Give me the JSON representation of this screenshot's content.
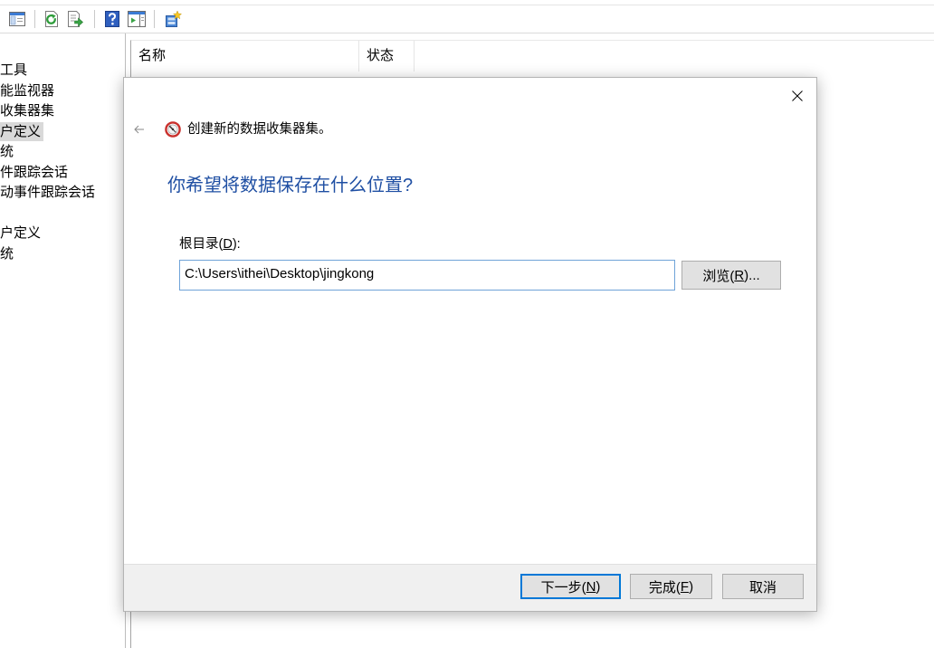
{
  "toolbar": {
    "icons": {
      "console_tree": "show-hide-console-tree-icon",
      "refresh": "refresh-icon",
      "export": "export-list-icon",
      "help": "help-icon",
      "action_pane": "show-hide-action-pane-icon",
      "new_set": "new-data-collector-set-icon"
    }
  },
  "tree": {
    "items": [
      {
        "label": "工具"
      },
      {
        "label": "能监视器"
      },
      {
        "label": "收集器集"
      },
      {
        "label": "户定义"
      },
      {
        "label": "统"
      },
      {
        "label": "件跟踪会话"
      },
      {
        "label": "动事件跟踪会话"
      },
      {
        "label": "户定义"
      },
      {
        "label": "统"
      }
    ]
  },
  "list": {
    "columns": [
      {
        "label": "名称"
      },
      {
        "label": "状态"
      }
    ]
  },
  "dialog": {
    "icons": {
      "close": "close-icon",
      "back": "back-arrow-icon",
      "wizard": "data-collector-set-icon"
    },
    "title": "创建新的数据收集器集。",
    "heading": "你希望将数据保存在什么位置?",
    "root_dir": {
      "label_before": "根目录(",
      "label_access_key": "D",
      "label_after": "):",
      "value": "C:\\Users\\ithei\\Desktop\\jingkong"
    },
    "browse_button": {
      "before": "浏览(",
      "access_key": "R",
      "after": ")..."
    },
    "footer": {
      "next": {
        "before": "下一步(",
        "access_key": "N",
        "after": ")"
      },
      "finish": {
        "before": "完成(",
        "access_key": "F",
        "after": ")"
      },
      "cancel": {
        "label": "取消"
      }
    }
  },
  "colors": {
    "heading": "#1f4fa3",
    "selection": "#d9d9d9",
    "input_border": "#6fa3d8",
    "default_button_border": "#0078d7",
    "footer_background": "#f0f0f0"
  }
}
